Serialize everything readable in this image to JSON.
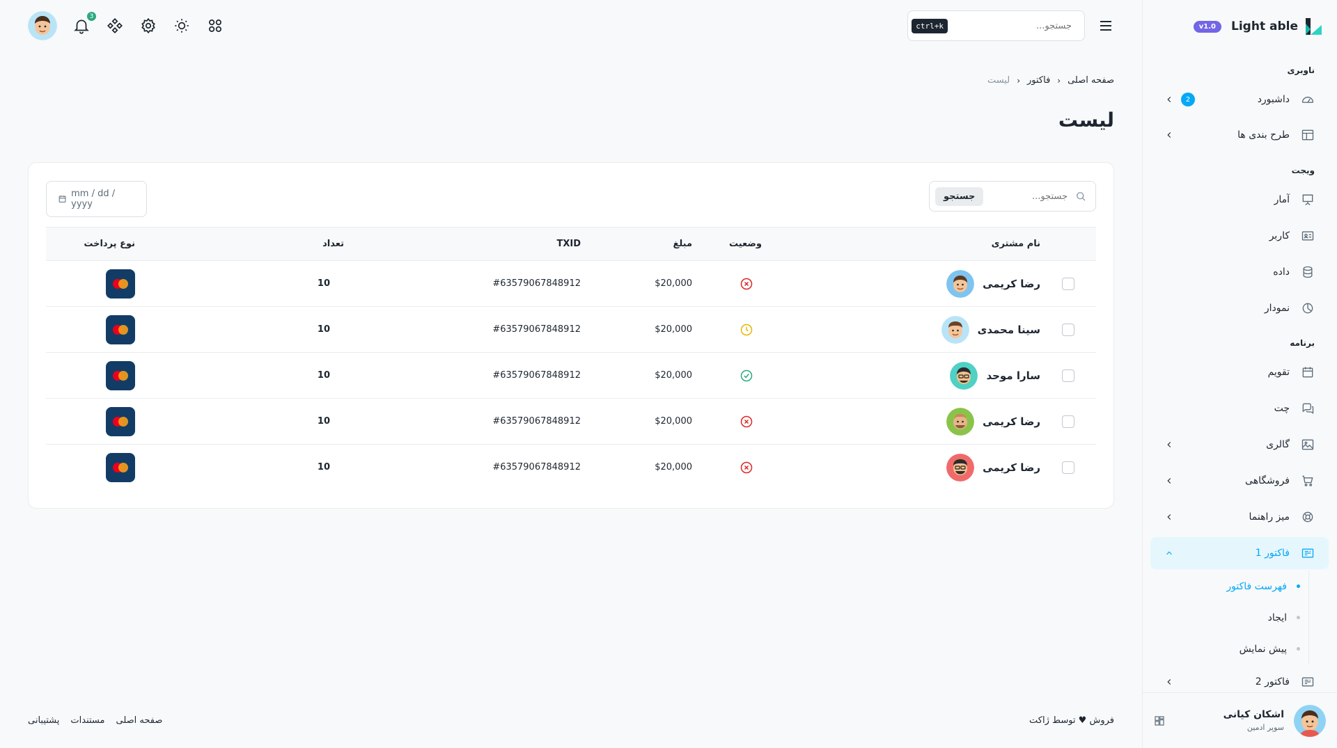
{
  "brand": {
    "name": "Light able",
    "version": "v1.0"
  },
  "header": {
    "search_placeholder": "جستجو...",
    "shortcut": "ctrl+k",
    "notification_count": "3"
  },
  "sidebar": {
    "captions": {
      "navigation": "ناوبری",
      "widget": "ویجت",
      "application": "برنامه"
    },
    "dashboard": {
      "label": "داشبورد",
      "badge": "2",
      "icon": "speedometer-icon"
    },
    "layouts": {
      "label": "طرح بندی ها",
      "icon": "layout-icon"
    },
    "stats": {
      "label": "آمار",
      "icon": "presentation-icon"
    },
    "user": {
      "label": "کاربر",
      "icon": "id-card-icon"
    },
    "data": {
      "label": "داده",
      "icon": "database-icon"
    },
    "chart": {
      "label": "نمودار",
      "icon": "pie-chart-icon"
    },
    "calendar": {
      "label": "تقویم",
      "icon": "calendar-icon"
    },
    "chat": {
      "label": "چت",
      "icon": "chat-icon"
    },
    "gallery": {
      "label": "گالری",
      "icon": "image-icon"
    },
    "shop": {
      "label": "فروشگاهی",
      "icon": "cart-icon"
    },
    "helpdesk": {
      "label": "میز راهنما",
      "icon": "lifebuoy-icon"
    },
    "invoice1": {
      "label": "فاکتور 1",
      "icon": "invoice-icon",
      "children": [
        "فهرست فاکتور",
        "ایجاد",
        "پیش نمایش"
      ]
    },
    "invoice2": {
      "label": "فاکتور 2",
      "icon": "invoice-icon"
    },
    "profile": {
      "name": "اشکان کیانی",
      "role": "سوپر ادمین"
    }
  },
  "breadcrumb": {
    "home": "صفحه اصلی",
    "section": "فاکتور",
    "current": "لیست"
  },
  "page_title": "لیست",
  "card": {
    "date_placeholder": "mm / dd / yyyy",
    "search_placeholder": "جستجو...",
    "search_button": "جستجو"
  },
  "table": {
    "headers": {
      "customer": "نام مشتری",
      "status": "وضعیت",
      "amount": "مبلغ",
      "txid": "TXID",
      "qty": "تعداد",
      "payment": "نوع پرداخت"
    },
    "rows": [
      {
        "name": "رضا کریمی",
        "status": "cancelled",
        "amount": "$20,000",
        "txid": "#63579067848912",
        "qty": "10",
        "payment": "mastercard"
      },
      {
        "name": "سینا محمدی",
        "status": "pending",
        "amount": "$20,000",
        "txid": "#63579067848912",
        "qty": "10",
        "payment": "mastercard"
      },
      {
        "name": "سارا موحد",
        "status": "paid",
        "amount": "$20,000",
        "txid": "#63579067848912",
        "qty": "10",
        "payment": "mastercard"
      },
      {
        "name": "رضا کریمی",
        "status": "cancelled",
        "amount": "$20,000",
        "txid": "#63579067848912",
        "qty": "10",
        "payment": "mastercard"
      },
      {
        "name": "رضا کریمی",
        "status": "cancelled",
        "amount": "$20,000",
        "txid": "#63579067848912",
        "qty": "10",
        "payment": "mastercard"
      }
    ]
  },
  "footer": {
    "credit": "فروش ♥ توسط ژاکت",
    "links": [
      "صفحه اصلی",
      "مستندات",
      "پشتیبانی"
    ]
  },
  "colors": {
    "primary": "#04a9f5",
    "success": "#2ca87f",
    "danger": "#dc2626",
    "warning": "#e5b700",
    "version_badge": "#7265e6"
  }
}
